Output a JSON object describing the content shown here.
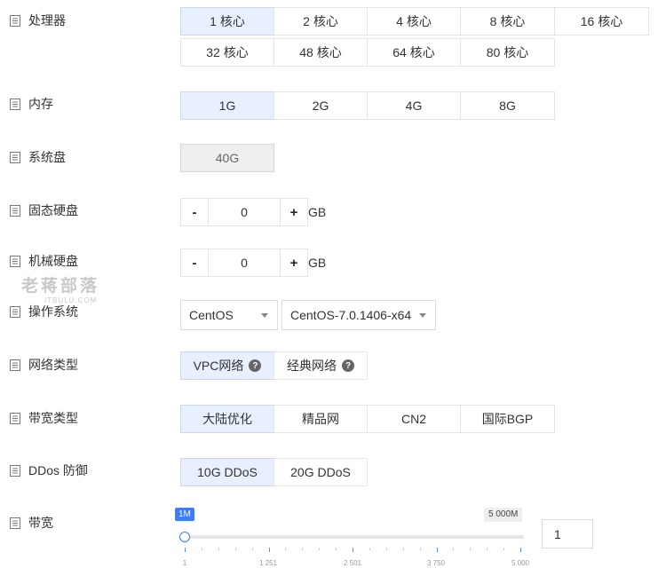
{
  "cpu": {
    "label": "处理器",
    "options": [
      "1 核心",
      "2 核心",
      "4 核心",
      "8 核心",
      "16 核心",
      "32 核心",
      "48 核心",
      "64 核心",
      "80 核心"
    ],
    "selected": "1 核心"
  },
  "memory": {
    "label": "内存",
    "options": [
      "1G",
      "2G",
      "4G",
      "8G"
    ],
    "selected": "1G"
  },
  "system_disk": {
    "label": "系统盘",
    "value": "40G"
  },
  "ssd": {
    "label": "固态硬盘",
    "minus": "-",
    "value": "0",
    "plus": "+",
    "unit": "GB"
  },
  "hdd": {
    "label": "机械硬盘",
    "minus": "-",
    "value": "0",
    "plus": "+",
    "unit": "GB"
  },
  "watermark": {
    "main": "老蒋部落",
    "sub": "ITBULU.COM"
  },
  "os": {
    "label": "操作系统",
    "distro": "CentOS",
    "version": "CentOS-7.0.1406-x64"
  },
  "network": {
    "label": "网络类型",
    "options": [
      "VPC网络",
      "经典网络"
    ],
    "selected": "VPC网络",
    "help_glyph": "?"
  },
  "bandwidth_type": {
    "label": "带宽类型",
    "options": [
      "大陆优化",
      "精品网",
      "CN2",
      "国际BGP"
    ],
    "selected": "大陆优化"
  },
  "ddos": {
    "label": "DDos 防御",
    "options": [
      "10G DDoS",
      "20G DDoS"
    ],
    "selected": "10G DDoS"
  },
  "bandwidth": {
    "label": "带宽",
    "min_tag": "1M",
    "max_tag": "5 000M",
    "value": 1,
    "min": 1,
    "max": 5000,
    "tick_labels": [
      "1",
      "1 251",
      "2 501",
      "3 750",
      "5 000"
    ],
    "input_value": "1"
  },
  "colors": {
    "accent": "#3f7cf5",
    "selected_bg": "#e8f0ff",
    "border": "#e4e4e4"
  }
}
